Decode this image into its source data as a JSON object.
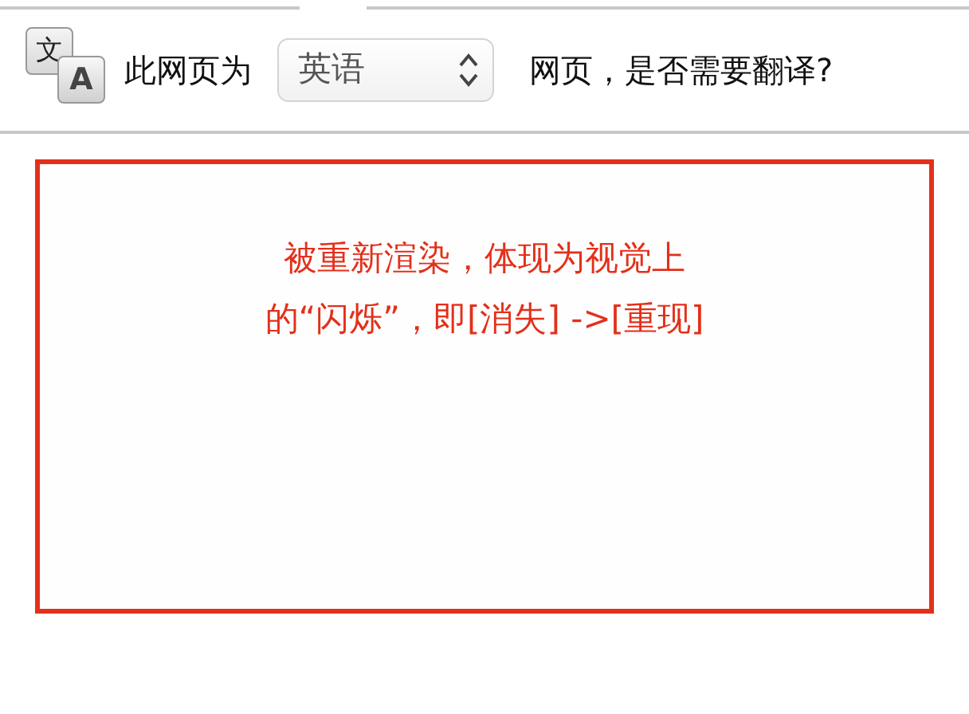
{
  "translate_bar": {
    "icon_glyphs": [
      "文",
      "A"
    ],
    "prefix": "此网页为",
    "language_select": {
      "value": "英语"
    },
    "suffix": "网页，是否需要翻译?"
  },
  "notice_box": {
    "lines": [
      "被重新渲染，体现为视觉上",
      "的“闪烁”，即[消失] ->[重现]"
    ]
  }
}
